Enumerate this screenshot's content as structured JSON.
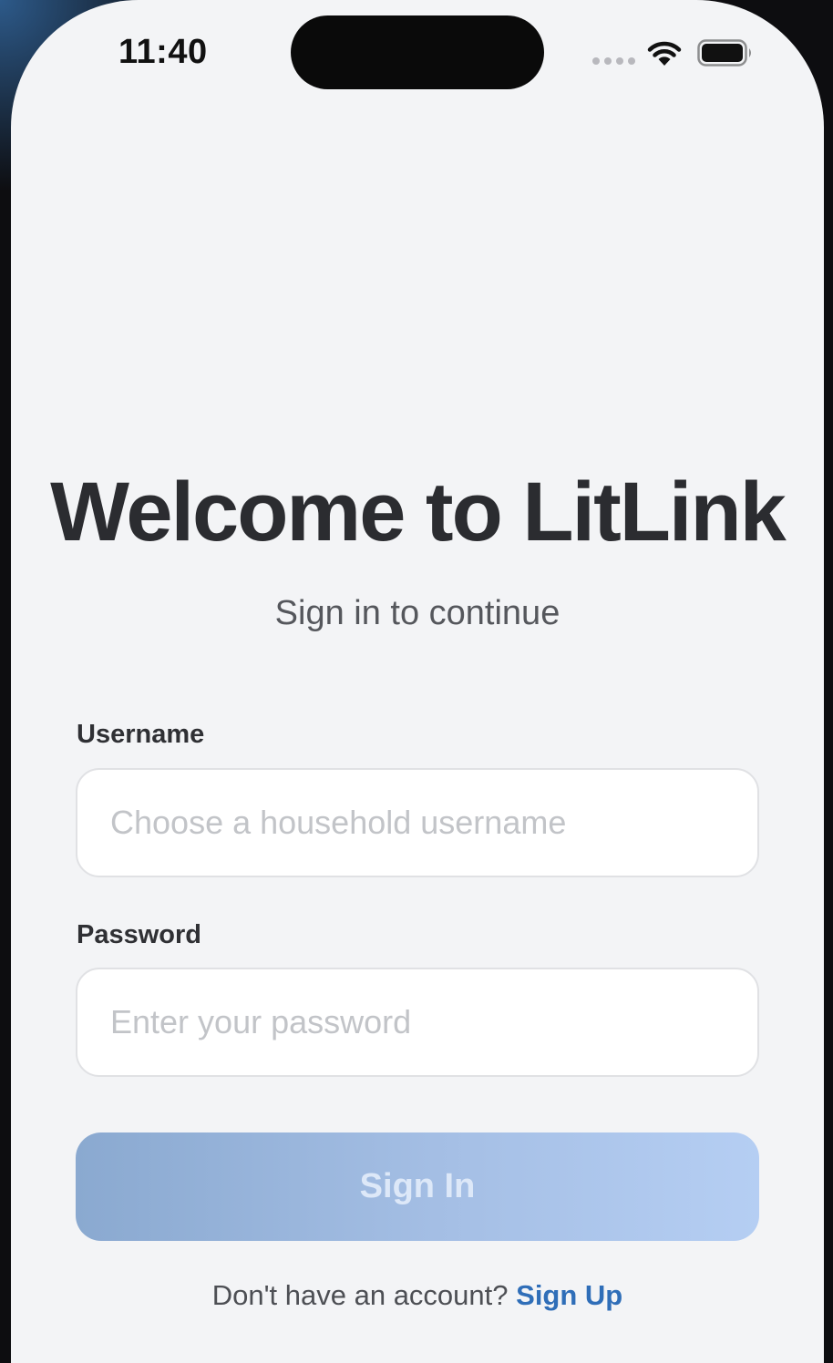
{
  "status_bar": {
    "time": "11:40"
  },
  "login": {
    "title": "Welcome to LitLink",
    "subtitle": "Sign in to continue",
    "username": {
      "label": "Username",
      "placeholder": "Choose a household username",
      "value": ""
    },
    "password": {
      "label": "Password",
      "placeholder": "Enter your password",
      "value": ""
    },
    "sign_in_label": "Sign In",
    "footer_prompt": "Don't have an account?",
    "sign_up_label": "Sign Up"
  },
  "colors": {
    "background": "#f3f4f6",
    "title_text": "#2b2c30",
    "link": "#2f6eb8",
    "button_gradient_start": "#8aa9d0",
    "button_gradient_end": "#b5cef3"
  }
}
